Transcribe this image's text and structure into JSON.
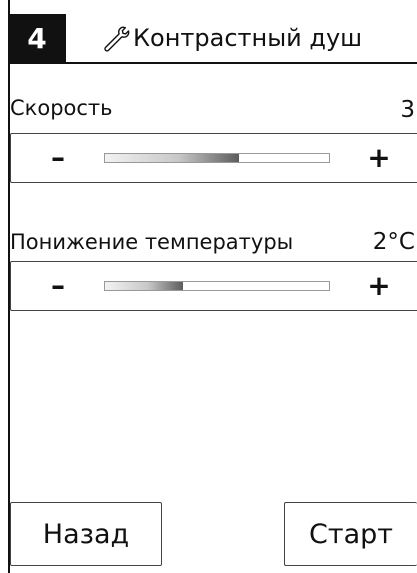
{
  "header": {
    "step_number": "4",
    "icon": "wrench-icon",
    "title": "Контрастный душ"
  },
  "params": [
    {
      "label": "Скорость",
      "value": "3",
      "minus_label": "–",
      "plus_label": "+",
      "level": 0.6
    },
    {
      "label": "Понижение температуры",
      "value": "2°C",
      "minus_label": "–",
      "plus_label": "+",
      "level": 0.35
    }
  ],
  "footer": {
    "back_label": "Назад",
    "start_label": "Старт"
  }
}
